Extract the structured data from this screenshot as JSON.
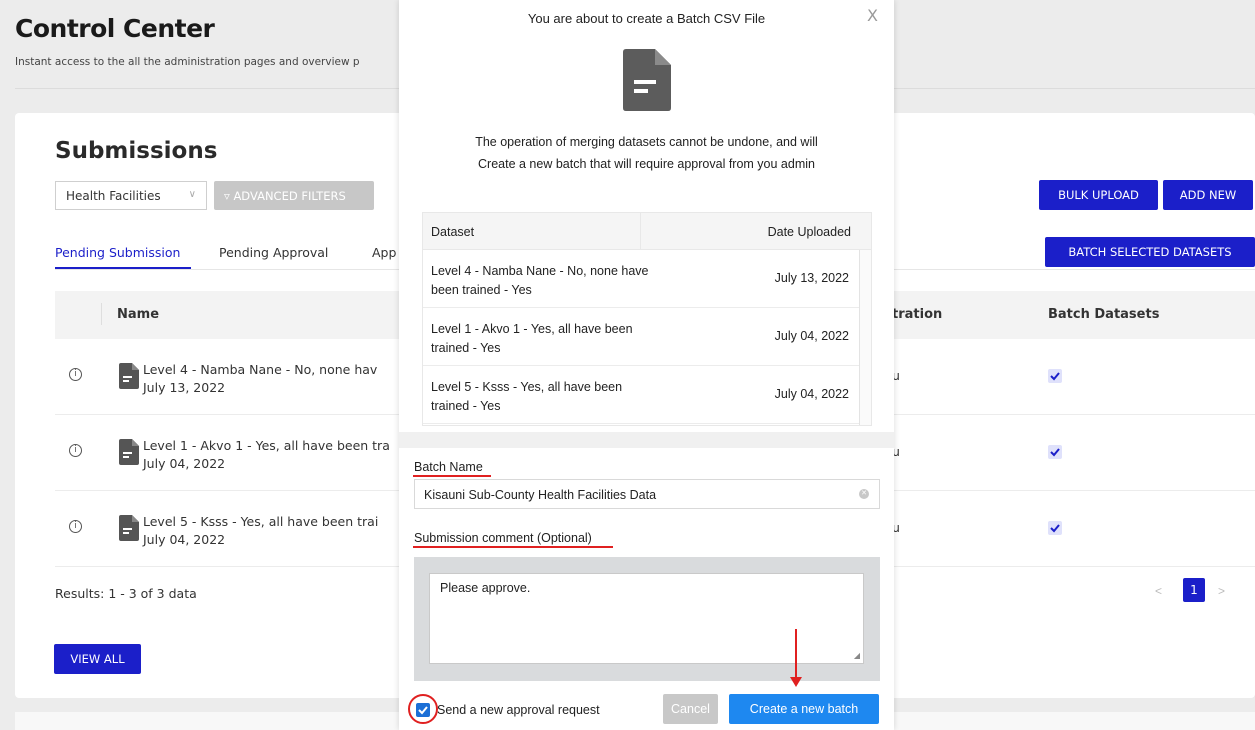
{
  "page": {
    "title": "Control Center",
    "subtitle": "Instant access to the all the administration pages and overview p"
  },
  "submissions": {
    "title": "Submissions",
    "filter_select": "Health Facilities",
    "advanced_filters": "ADVANCED FILTERS",
    "bulk_upload": "BULK UPLOAD",
    "add_new": "ADD NEW",
    "batch_selected": "BATCH SELECTED DATASETS",
    "tabs": [
      {
        "label": "Pending Submission",
        "active": true
      },
      {
        "label": "Pending Approval",
        "active": false
      },
      {
        "label": "App",
        "active": false
      }
    ],
    "columns": {
      "name": "Name",
      "registration": "tration",
      "batch": "Batch Datasets"
    },
    "rows": [
      {
        "name": "Level 4 - Namba Nane - No, none hav",
        "date": "July 13, 2022",
        "registration": "u",
        "checked": true
      },
      {
        "name": "Level 1 - Akvo 1 - Yes, all have been tra",
        "date": "July 04, 2022",
        "registration": "u",
        "checked": true
      },
      {
        "name": "Level 5 - Ksss - Yes, all have been trai",
        "date": "July 04, 2022",
        "registration": "u",
        "checked": true
      }
    ],
    "results": "Results: 1 - 3 of 3 data",
    "page_number": "1",
    "prev": "<",
    "next": ">",
    "view_all": "VIEW ALL"
  },
  "modal": {
    "title": "You are about to create a Batch CSV File",
    "close": "X",
    "warning": "The operation of merging datasets cannot be undone, and will Create a new batch that will require approval from you admin",
    "table": {
      "col_dataset": "Dataset",
      "col_date": "Date Uploaded",
      "rows": [
        {
          "dataset": "Level 4 - Namba Nane - No, none have been trained - Yes",
          "date": "July 13, 2022"
        },
        {
          "dataset": "Level 1 - Akvo 1 - Yes, all have been trained - Yes",
          "date": "July 04, 2022"
        },
        {
          "dataset": "Level 5 - Ksss - Yes, all have been trained - Yes",
          "date": "July 04, 2022"
        }
      ]
    },
    "batch_name_label": "Batch Name",
    "batch_name_value": "Kisauni Sub-County Health Facilities Data",
    "comment_label": "Submission comment (Optional)",
    "comment_value": "Please approve.",
    "send_request_label": "Send a new approval request",
    "send_request_checked": true,
    "cancel": "Cancel",
    "create": "Create a new batch"
  },
  "colors": {
    "primary": "#1b1fc9",
    "create_button": "#1e88f0",
    "annotation": "#e02020"
  }
}
